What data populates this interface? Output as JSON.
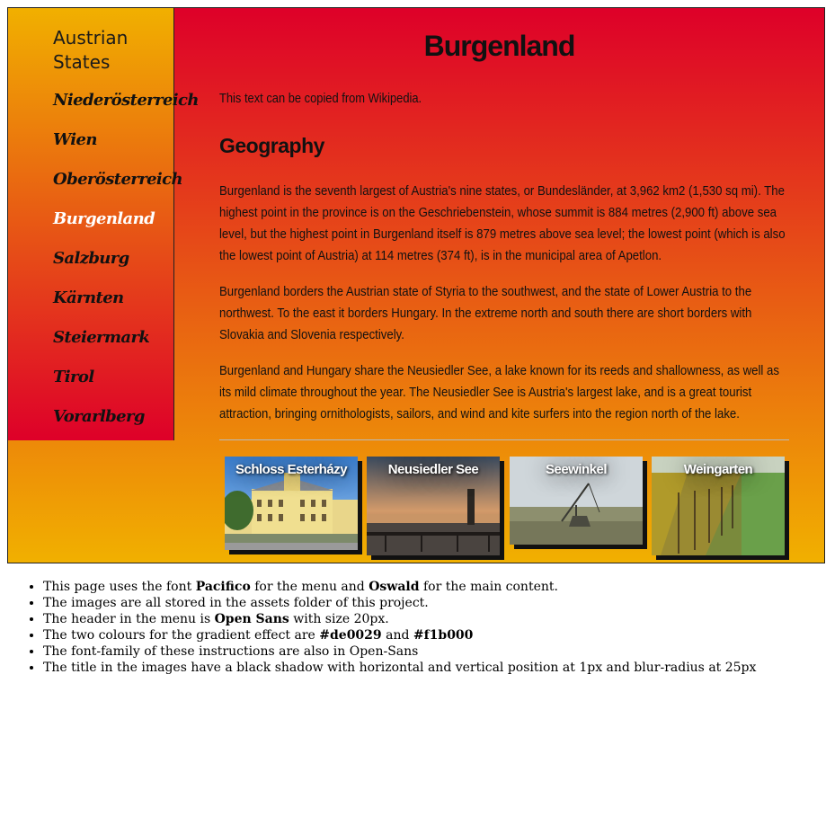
{
  "sidebar": {
    "header": "Austrian States",
    "items": [
      {
        "label": "Niederösterreich",
        "active": false
      },
      {
        "label": "Wien",
        "active": false
      },
      {
        "label": "Oberösterreich",
        "active": false
      },
      {
        "label": "Burgenland",
        "active": true
      },
      {
        "label": "Salzburg",
        "active": false
      },
      {
        "label": "Kärnten",
        "active": false
      },
      {
        "label": "Steiermark",
        "active": false
      },
      {
        "label": "Tirol",
        "active": false
      },
      {
        "label": "Vorarlberg",
        "active": false
      }
    ]
  },
  "main": {
    "title": "Burgenland",
    "intro": "This text can be copied from Wikipedia.",
    "section_heading": "Geography",
    "paragraphs": [
      "Burgenland is the seventh largest of Austria's nine states, or Bundesländer, at 3,962 km2 (1,530 sq mi). The highest point in the province is on the Geschriebenstein, whose summit is 884 metres (2,900 ft) above sea level, but the highest point in Burgenland itself is 879 metres above sea level; the lowest point (which is also the lowest point of Austria) at 114 metres (374 ft), is in the municipal area of Apetlon.",
      "Burgenland borders the Austrian state of Styria to the southwest, and the state of Lower Austria to the northwest. To the east it borders Hungary. In the extreme north and south there are short borders with Slovakia and Slovenia respectively.",
      "Burgenland and Hungary share the Neusiedler See, a lake known for its reeds and shallowness, as well as its mild climate throughout the year. The Neusiedler See is Austria's largest lake, and is a great tourist attraction, bringing ornithologists, sailors, and wind and kite surfers into the region north of the lake."
    ],
    "gallery": [
      {
        "caption": "Schloss Esterházy"
      },
      {
        "caption": "Neusiedler See"
      },
      {
        "caption": "Seewinkel"
      },
      {
        "caption": "Weingarten"
      }
    ]
  },
  "notes": [
    {
      "pre": "This page uses the font ",
      "b1": "Pacifico",
      "mid": " for the menu and ",
      "b2": "Oswald",
      "post": " for the main content."
    },
    {
      "pre": "The images are all stored in the assets folder of this project.",
      "b1": "",
      "mid": "",
      "b2": "",
      "post": ""
    },
    {
      "pre": "The header in the menu is ",
      "b1": "Open Sans",
      "mid": " with size 20px.",
      "b2": "",
      "post": ""
    },
    {
      "pre": "The two colours for the gradient effect are ",
      "b1": "#de0029",
      "mid": " and ",
      "b2": "#f1b000",
      "post": ""
    },
    {
      "pre": "The font-family of these instructions are also in Open-Sans",
      "b1": "",
      "mid": "",
      "b2": "",
      "post": ""
    },
    {
      "pre": "The title in the images have a black shadow with horizontal and vertical position at 1px and blur-radius at 25px",
      "b1": "",
      "mid": "",
      "b2": "",
      "post": ""
    }
  ],
  "colors": {
    "gradient_start": "#de0029",
    "gradient_end": "#f1b000",
    "active_menu": "#ffffff"
  }
}
